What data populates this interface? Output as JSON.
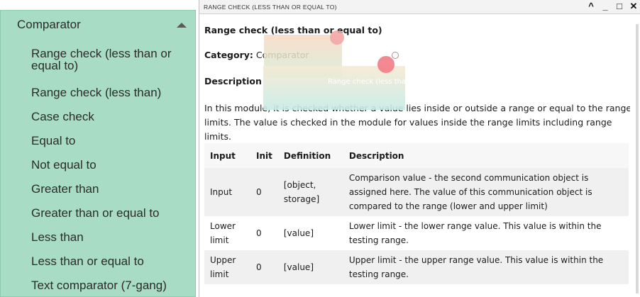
{
  "sidebar": {
    "header": "Comparator",
    "items": [
      "Range check (less than or equal to)",
      "Range check (less than)",
      "Case check",
      "Equal to",
      "Not equal to",
      "Greater than",
      "Greater than or equal to",
      "Less than",
      "Less than or equal to",
      "Text comparator (7-gang)"
    ]
  },
  "window": {
    "title": "Range check (less than or equal to)",
    "controls": [
      "^",
      "_",
      "□",
      "✕"
    ]
  },
  "module": {
    "name": "Range check (less than or equal to)",
    "category_label": "Category:",
    "category_value": "Comparator",
    "description_heading": "Description",
    "description_line1": "In this module, it is checked whether a value lies inside or outside a range or equal to the range",
    "description_line2": "limits. The value is checked in the module for values inside the range limits including range limits.",
    "drag_ghost_label": "Range check (less than or equal to)"
  },
  "table": {
    "headers": [
      "Input",
      "Init",
      "Definition",
      "Description"
    ],
    "rows": [
      {
        "input": "Input",
        "init": "0",
        "definition_l1": "[object,",
        "definition_l2": "storage]",
        "desc_l1": "Comparison value - the second communication object is",
        "desc_l2": "assigned here. The value of this communication object is",
        "desc_l3": "compared to the range (lower and upper limit)"
      },
      {
        "input_l1": "Lower",
        "input_l2": "limit",
        "init": "0",
        "definition": "[value]",
        "desc_l1": "Lower limit - the lower range value. This value is within the",
        "desc_l2": "testing range."
      },
      {
        "input_l1": "Upper",
        "input_l2": "limit",
        "init": "0",
        "definition": "[value]",
        "desc_l1": "Upper limit - the upper range value. This value is within the",
        "desc_l2": "testing range."
      }
    ]
  }
}
